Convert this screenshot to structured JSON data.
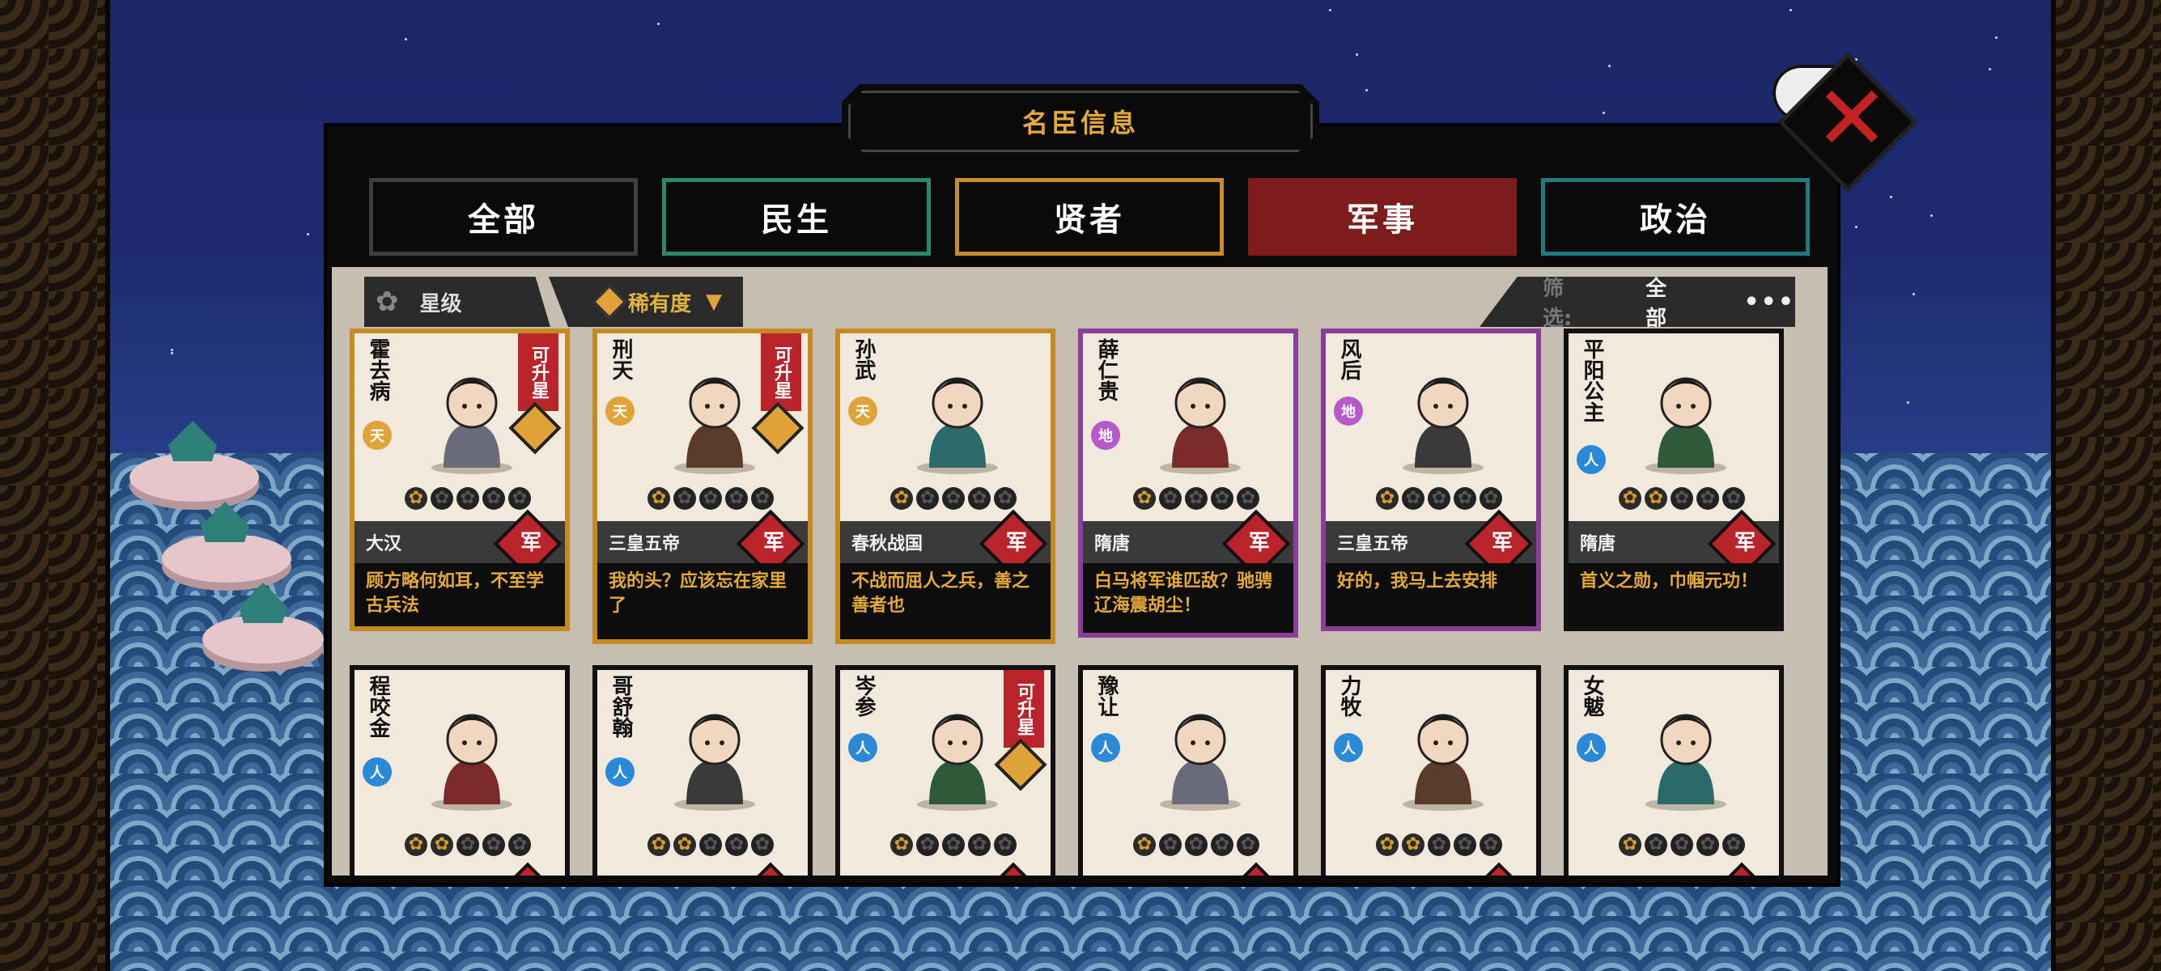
{
  "title": "名臣信息",
  "tabs": [
    {
      "label": "全部"
    },
    {
      "label": "民生"
    },
    {
      "label": "贤者"
    },
    {
      "label": "军事"
    },
    {
      "label": "政治"
    }
  ],
  "active_tab": "军事",
  "filters": {
    "star_label": "星级",
    "rarity_label": "稀有度",
    "filter_label": "筛选:",
    "filter_value": "全部",
    "more": "•••"
  },
  "close_icon": "close-x-icon",
  "card_badge": "军",
  "upgrade_label": "可升星",
  "cards_row1": [
    {
      "name": "霍去病",
      "rank": "天",
      "rank_type": "tian",
      "stars": 1,
      "era": "大汉",
      "quote": "顾方略何如耳，不至学古兵法",
      "upgrade": true,
      "frame": "gold"
    },
    {
      "name": "刑天",
      "rank": "天",
      "rank_type": "tian",
      "stars": 1,
      "era": "三皇五帝",
      "quote": "我的头？应该忘在家里了",
      "upgrade": true,
      "frame": "gold"
    },
    {
      "name": "孙武",
      "rank": "天",
      "rank_type": "tian",
      "stars": 1,
      "era": "春秋战国",
      "quote": "不战而屈人之兵，善之善者也",
      "upgrade": false,
      "frame": "gold"
    },
    {
      "name": "薛仁贵",
      "rank": "地",
      "rank_type": "di",
      "stars": 1,
      "era": "隋唐",
      "quote": "白马将军谁匹敌？驰骋辽海震胡尘！",
      "upgrade": false,
      "frame": "purple"
    },
    {
      "name": "风后",
      "rank": "地",
      "rank_type": "di",
      "stars": 1,
      "era": "三皇五帝",
      "quote": "好的，我马上去安排",
      "upgrade": false,
      "frame": "purple"
    },
    {
      "name": "平阳公主",
      "rank": "人",
      "rank_type": "ren",
      "stars": 2,
      "era": "隋唐",
      "quote": "首义之勋，巾帼元功！",
      "upgrade": false,
      "frame": "plain"
    }
  ],
  "cards_row2": [
    {
      "name": "程咬金",
      "rank": "人",
      "rank_type": "ren",
      "stars": 2,
      "upgrade": false
    },
    {
      "name": "哥舒翰",
      "rank": "人",
      "rank_type": "ren",
      "stars": 2,
      "upgrade": false
    },
    {
      "name": "岑参",
      "rank": "人",
      "rank_type": "ren",
      "stars": 1,
      "upgrade": true
    },
    {
      "name": "豫让",
      "rank": "人",
      "rank_type": "ren",
      "stars": 1,
      "upgrade": false
    },
    {
      "name": "力牧",
      "rank": "人",
      "rank_type": "ren",
      "stars": 2,
      "upgrade": false
    },
    {
      "name": "女魃",
      "rank": "人",
      "rank_type": "ren",
      "stars": 1,
      "upgrade": false
    }
  ]
}
